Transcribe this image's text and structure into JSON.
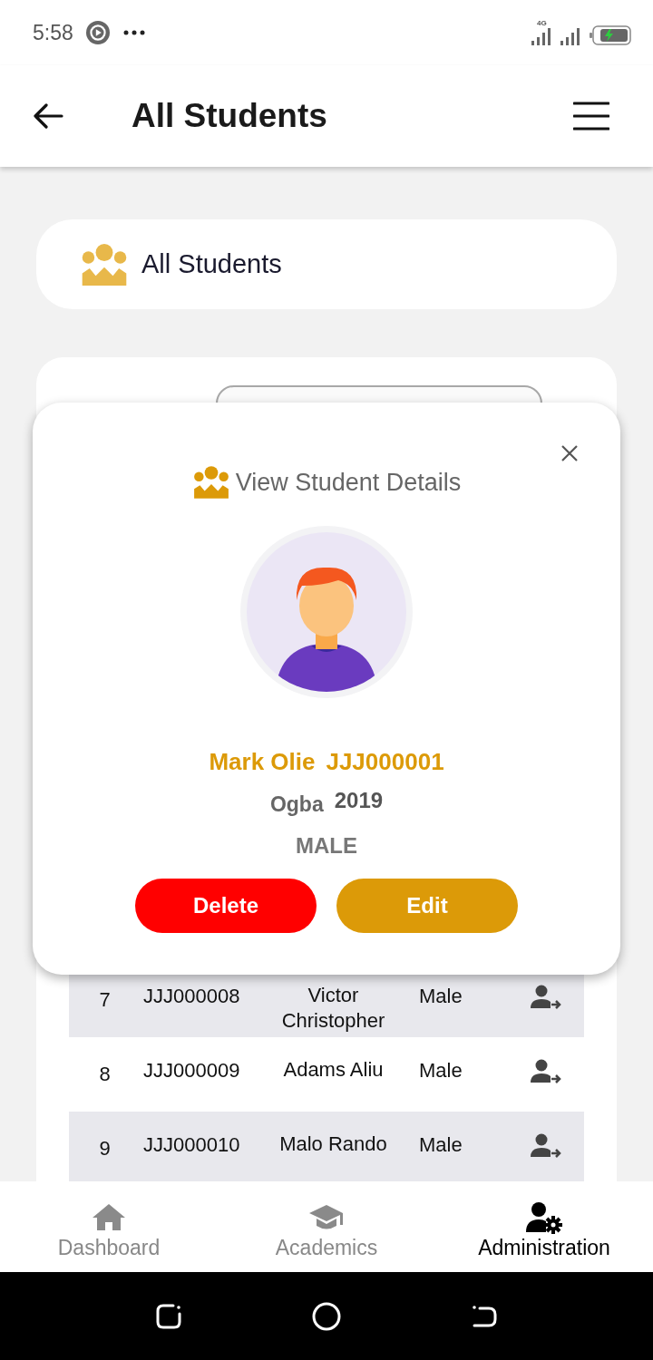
{
  "status_bar": {
    "time": "5:58",
    "network": "4G"
  },
  "header": {
    "title": "All Students"
  },
  "page_card": {
    "title": "All Students"
  },
  "table": {
    "rows": [
      {
        "number": "7",
        "id": "JJJ000008",
        "name": "Victor Christopher",
        "gender": "Male"
      },
      {
        "number": "8",
        "id": "JJJ000009",
        "name": "Adams Aliu",
        "gender": "Male"
      },
      {
        "number": "9",
        "id": "JJJ000010",
        "name": "Malo Rando",
        "gender": "Male"
      }
    ]
  },
  "dialog": {
    "title": "View Student Details",
    "name": "Mark Olie",
    "student_id": "JJJ000001",
    "branch": "Ogba",
    "year": "2019",
    "gender": "MALE",
    "buttons": [
      {
        "label": "Delete",
        "kind": "danger"
      },
      {
        "label": "Edit",
        "kind": "primary"
      }
    ]
  },
  "bottom_nav": [
    {
      "label": "Dashboard",
      "selected": false
    },
    {
      "label": "Academics",
      "selected": false
    },
    {
      "label": "Administration",
      "selected": true
    }
  ]
}
